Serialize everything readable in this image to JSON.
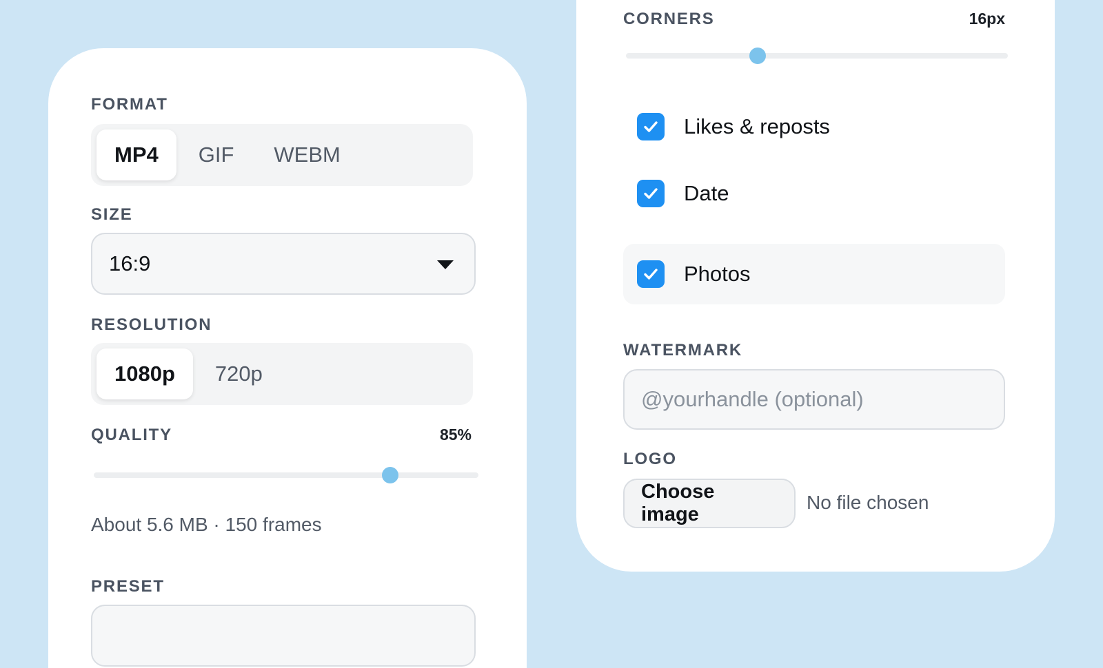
{
  "export_panel": {
    "format": {
      "label": "FORMAT",
      "options": [
        "MP4",
        "GIF",
        "WEBM"
      ],
      "selected": "MP4"
    },
    "size": {
      "label": "SIZE",
      "value": "16:9"
    },
    "resolution": {
      "label": "RESOLUTION",
      "options": [
        "1080p",
        "720p"
      ],
      "selected": "1080p"
    },
    "quality": {
      "label": "QUALITY",
      "value_text": "85%",
      "value_fraction": 0.77
    },
    "estimate": "About 5.6 MB · 150 frames",
    "preset": {
      "label": "PRESET"
    }
  },
  "style_panel": {
    "corners": {
      "label": "CORNERS",
      "value_text": "16px",
      "value_fraction": 0.345
    },
    "toggles": [
      {
        "label": "Likes & reposts",
        "checked": true
      },
      {
        "label": "Date",
        "checked": true
      },
      {
        "label": "Photos",
        "checked": true
      }
    ],
    "watermark": {
      "label": "WATERMARK",
      "placeholder": "@yourhandle (optional)",
      "value": ""
    },
    "logo": {
      "label": "LOGO",
      "button_label": "Choose image",
      "status": "No file chosen"
    }
  },
  "colors": {
    "background": "#cde5f5",
    "accent_checkbox": "#1e90f2",
    "slider_thumb": "#7cc3ec"
  }
}
